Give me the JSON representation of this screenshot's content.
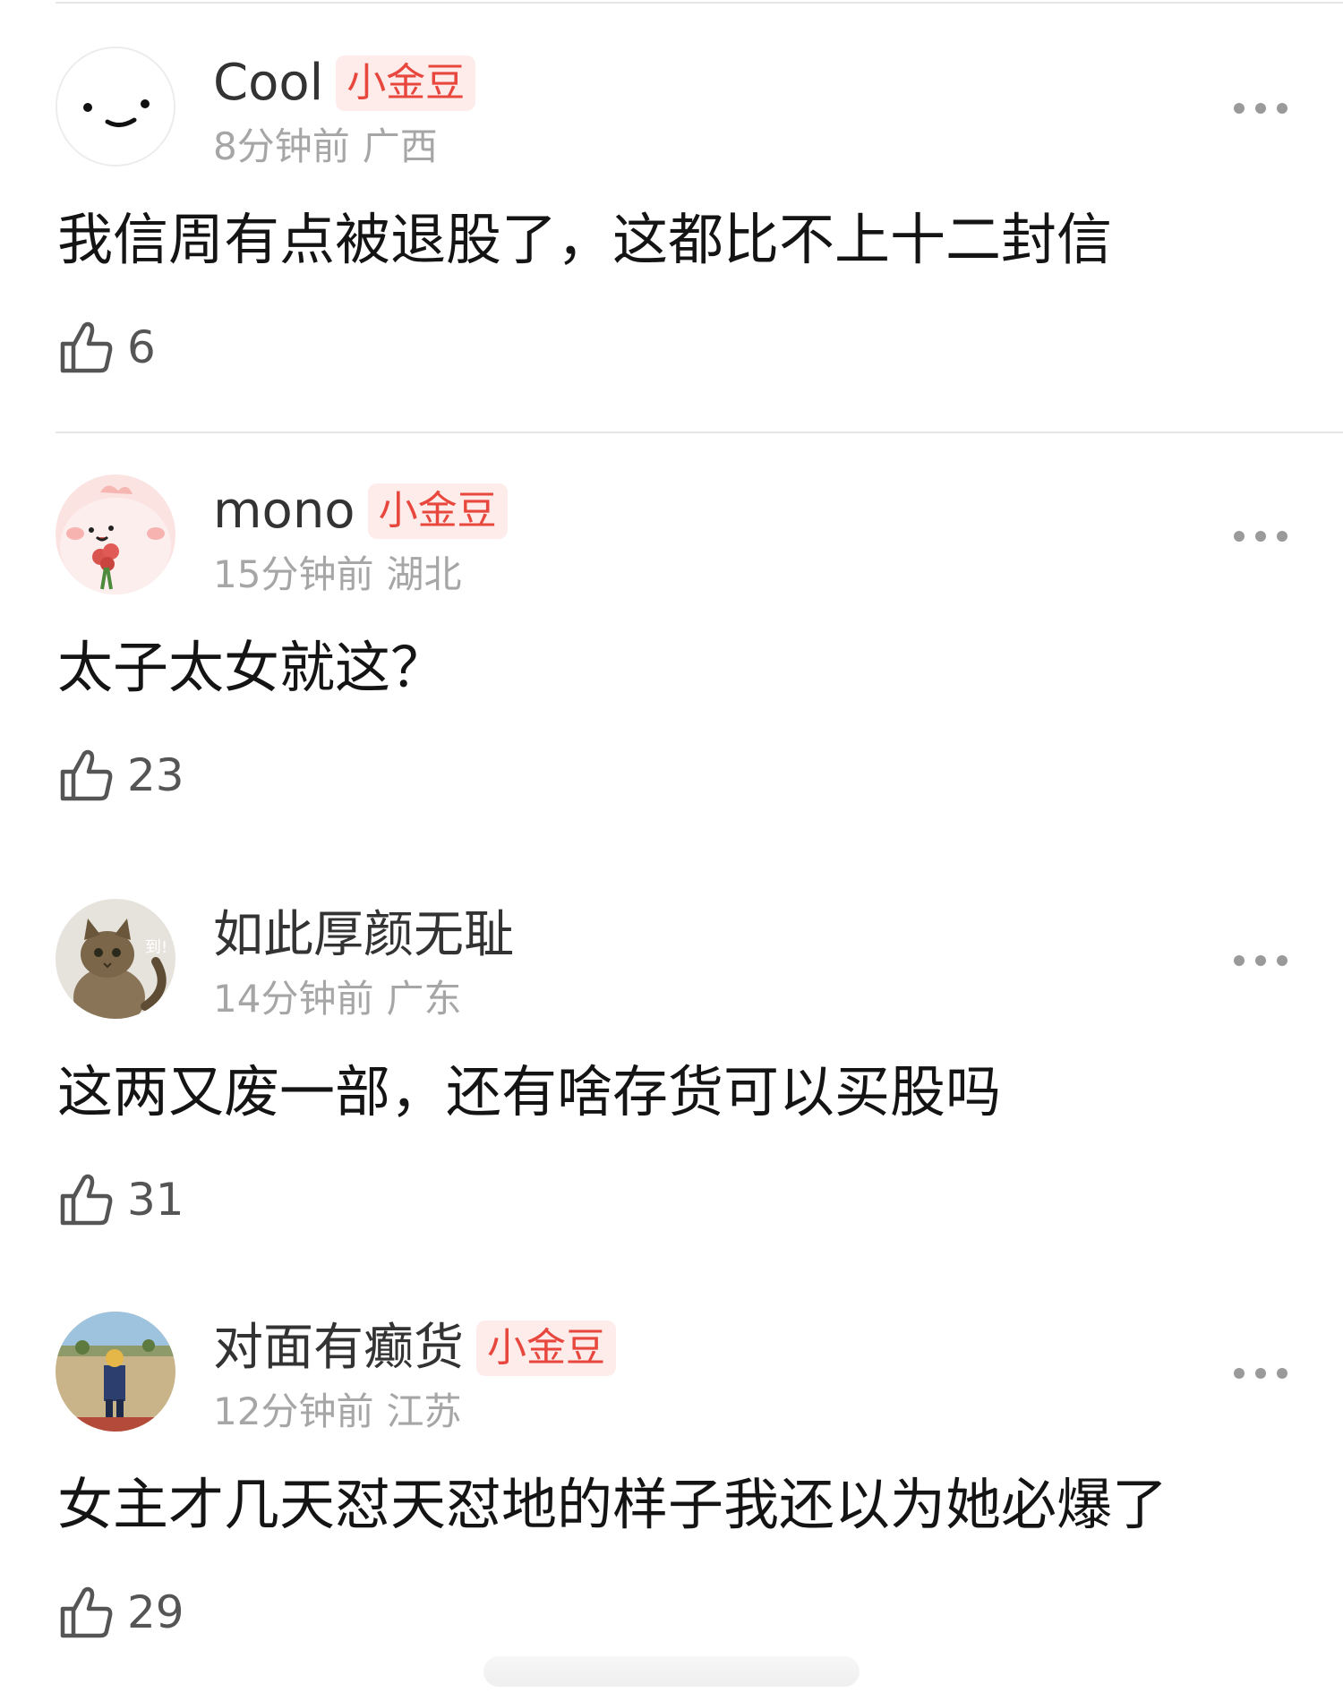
{
  "comments": [
    {
      "username": "Cool",
      "badge": "小金豆",
      "time": "8分钟前",
      "location": "广西",
      "text": "我信周有点被退股了，这都比不上十二封信",
      "likes": "6"
    },
    {
      "username": "mono",
      "badge": "小金豆",
      "time": "15分钟前",
      "location": "湖北",
      "text": "太子太女就这？",
      "likes": "23"
    },
    {
      "username": "如此厚颜无耻",
      "badge": "",
      "time": "14分钟前",
      "location": "广东",
      "text": "这两又废一部，还有啥存货可以买股吗",
      "likes": "31",
      "avatar_text": "到!"
    },
    {
      "username": "对面有癫货",
      "badge": "小金豆",
      "time": "12分钟前",
      "location": "江苏",
      "text": "女主才几天怼天怼地的样子我还以为她必爆了",
      "likes": "29"
    }
  ],
  "colors": {
    "badge_text": "#e8473e",
    "badge_bg": "#fdecea",
    "meta_text": "#a6a6a6"
  },
  "icons": {
    "more": "more-dots-icon",
    "like": "thumbs-up-icon"
  }
}
